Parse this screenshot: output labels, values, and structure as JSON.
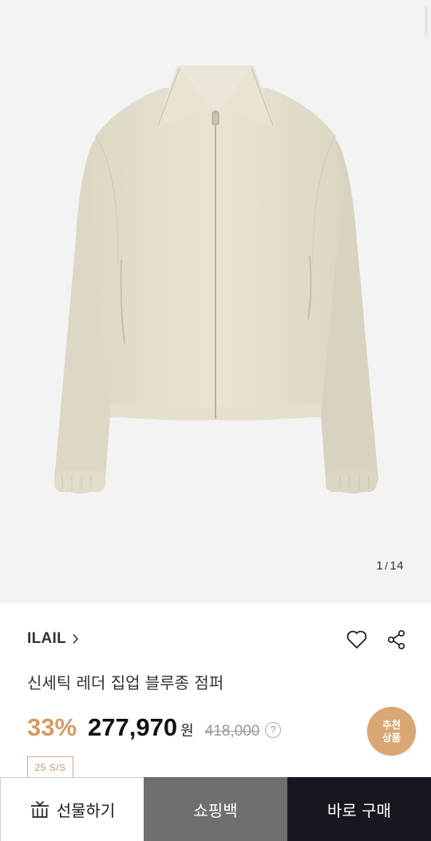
{
  "gallery": {
    "current": "1",
    "separator": "/",
    "total": "14",
    "image_alt": "beige zip-up jacket product photo"
  },
  "product": {
    "brand": "ILAIL",
    "title": "신세틱 레더 집업 블루종 점퍼",
    "discount": "33%",
    "price": "277,970",
    "currency": "원",
    "original_price": "418,000",
    "help_glyph": "?",
    "season_tag": "25 S/S"
  },
  "recommend": {
    "line1": "추천",
    "line2": "상품"
  },
  "actions": {
    "gift_label": "선물하기",
    "bag_label": "쇼핑백",
    "buy_label": "바로 구매"
  },
  "icons": {
    "wishlist": "heart-icon",
    "share": "share-icon",
    "brand_arrow": "chevron-right-icon",
    "gift": "gift-icon"
  },
  "colors": {
    "accent": "#d49b63",
    "reco_badge": "#d8a774",
    "bag_button": "#6f6f6f",
    "buy_button": "#16181f"
  }
}
